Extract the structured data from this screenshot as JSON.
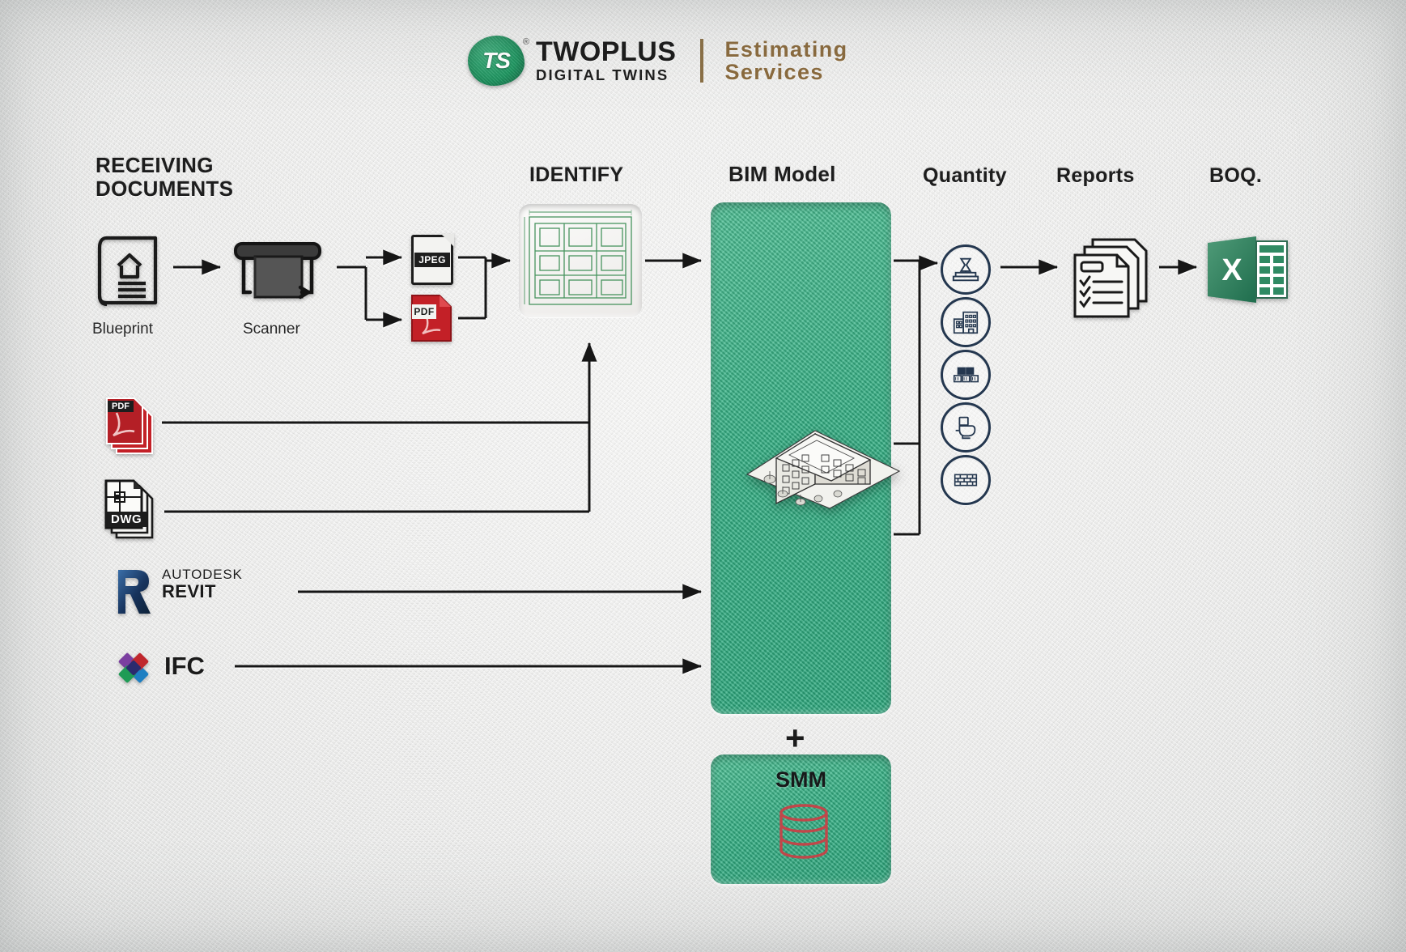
{
  "brand": {
    "mark_text": "TS",
    "registered": "®",
    "name_line1": "TWOPLUS",
    "name_line2": "DIGITAL TWINS",
    "tagline_line1": "Estimating",
    "tagline_line2": "Services",
    "accent_green": "#1f9a63",
    "accent_bronze": "#8a6a3d"
  },
  "headings": {
    "receiving": "RECEIVING\nDOCUMENTS",
    "identify": "IDENTIFY",
    "bim": "BIM Model",
    "quantity": "Quantity",
    "reports": "Reports",
    "boq": "BOQ."
  },
  "captions": {
    "blueprint": "Blueprint",
    "scanner": "Scanner"
  },
  "file_icons": {
    "jpeg": "JPEG",
    "pdf_small": "PDF",
    "pdf_stack": "PDF",
    "dwg": "DWG"
  },
  "sources": {
    "autodesk": "AUTODESK",
    "revit": "REVIT",
    "ifc": "IFC"
  },
  "bim": {
    "plus": "+",
    "smm_label": "SMM",
    "panel_color": "#32b184"
  },
  "quantity_items": [
    {
      "icon": "concrete-foundation-icon",
      "label": "Concrete"
    },
    {
      "icon": "building-icon",
      "label": "Building"
    },
    {
      "icon": "masonry-blocks-icon",
      "label": "Blocks"
    },
    {
      "icon": "toilet-fixture-icon",
      "label": "Sanitary"
    },
    {
      "icon": "brick-wall-icon",
      "label": "Brickwork"
    }
  ],
  "outputs": {
    "reports_icon": "checklist-documents-icon",
    "boq_icon": "excel-spreadsheet-icon",
    "excel_letter": "X"
  }
}
